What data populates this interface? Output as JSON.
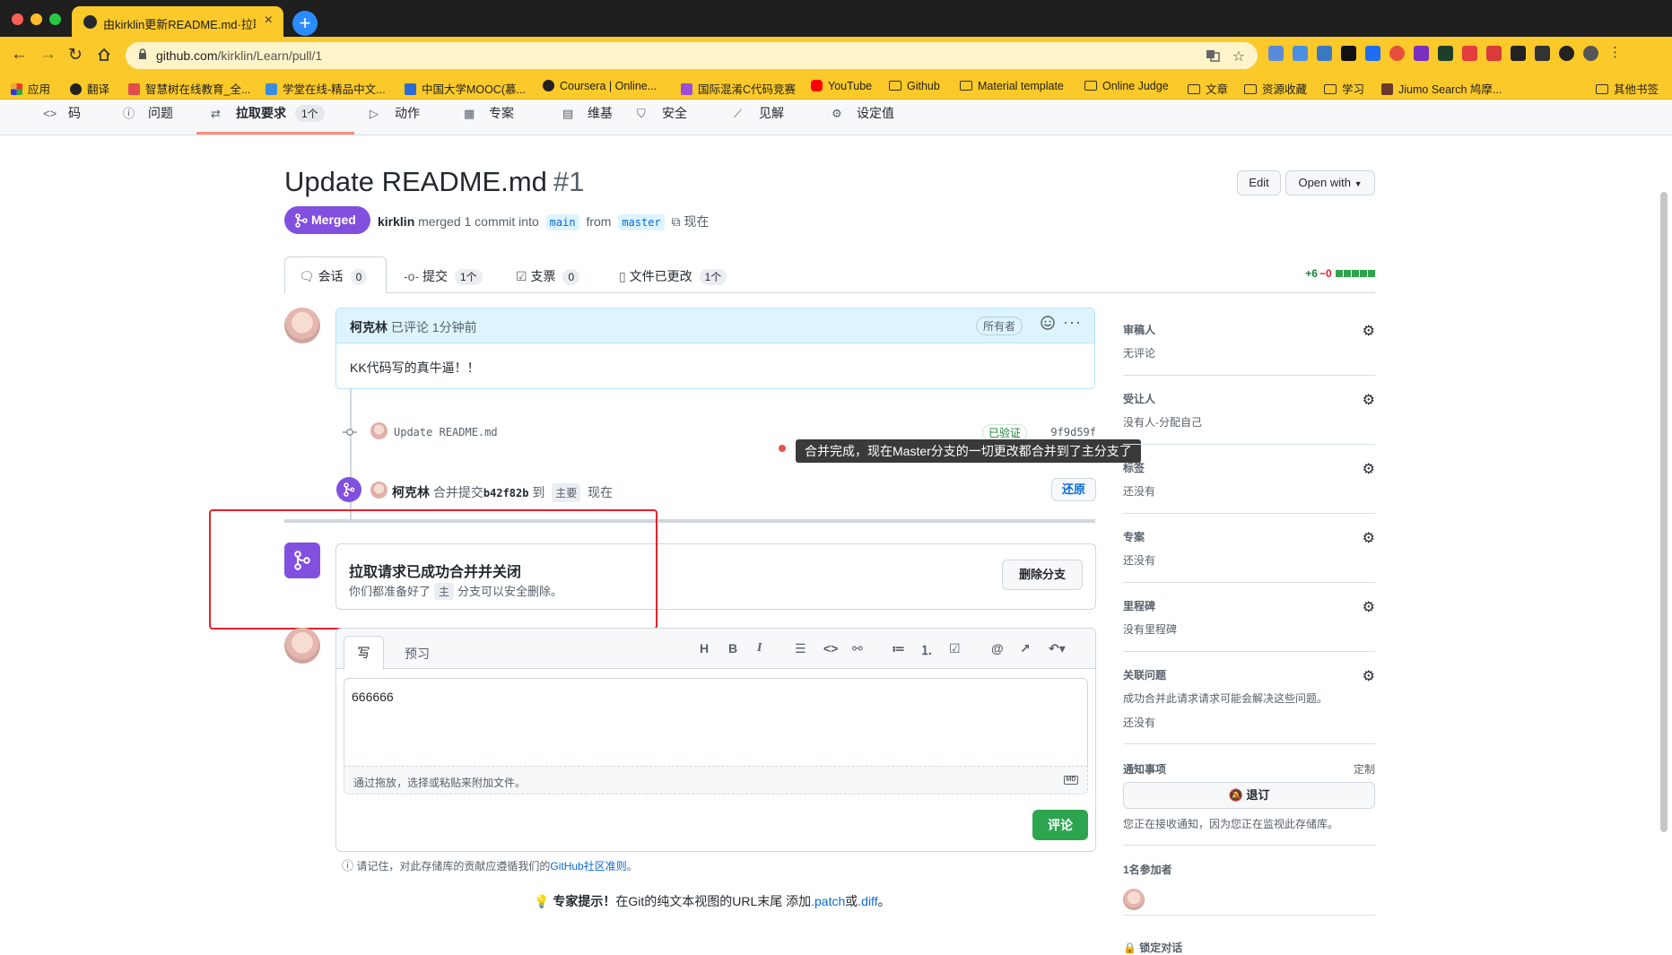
{
  "browser": {
    "tab_title": "由kirklin更新README.md·拉取…",
    "url_host": "github.com",
    "url_path": "/kirklin/Learn/pull/1",
    "bookmarks": [
      "应用",
      "翻译",
      "智慧树在线教育_全...",
      "学堂在线-精品中文...",
      "中国大学MOOC(慕...",
      "Coursera | Online...",
      "国际混淆C代码竞赛",
      "YouTube",
      "Github",
      "Material template",
      "Online Judge",
      "文章",
      "资源收藏",
      "学习",
      "Jiumo Search 鸠摩...",
      "其他书签"
    ],
    "colors": {
      "accent": "#fbc92a"
    }
  },
  "repo_nav": {
    "code": "码",
    "issues": "问题",
    "pulls": "拉取要求",
    "pulls_count": "1个",
    "actions": "动作",
    "projects": "专案",
    "wiki": "维基",
    "security": "安全",
    "insights": "见解",
    "settings": "设定值"
  },
  "pr": {
    "title": "Update README.md",
    "number": "#1",
    "edit": "Edit",
    "open_with": "Open with",
    "state": "Merged",
    "author": "kirklin",
    "meta_text": "merged 1 commit into",
    "base": "main",
    "from": "from",
    "head": "master",
    "time": "现在"
  },
  "pr_tabs": [
    {
      "label": "会话",
      "count": "0"
    },
    {
      "label": "提交",
      "count": "1个"
    },
    {
      "label": "支票",
      "count": "0"
    },
    {
      "label": "文件已更改",
      "count": "1个"
    }
  ],
  "diffstat": {
    "add": "+6",
    "del": "−0"
  },
  "comment": {
    "author": "柯克林",
    "action": "已评论 1分钟前",
    "role": "所有者",
    "body": "KK代码写的真牛逼！！"
  },
  "commit": {
    "message": "Update README.md",
    "verified": "已验证",
    "sha": "9f9d59f"
  },
  "tooltip": "合并完成，现在Master分支的一切更改都合并到了主分支了",
  "merge_event": {
    "author": "柯克林",
    "text": "合并提交",
    "sha": "b42f82b",
    "to": "到",
    "branch": "主要",
    "time": "现在",
    "revert": "还原"
  },
  "merged_box": {
    "title": "拉取请求已成功合并并关闭",
    "sub_pre": "你们都准备好了",
    "branch": "主",
    "sub_post": "分支可以安全删除。",
    "delete": "删除分支"
  },
  "new_comment": {
    "write": "写",
    "preview": "预习",
    "text": "666666",
    "attach": "通过拖放，选择或粘贴来附加文件。",
    "md": "MD",
    "submit": "评论"
  },
  "guideline": {
    "text": "请记住，对此存储库的贡献应遵循我们的",
    "link": "GitHub社区准则",
    "end": "。"
  },
  "protip": {
    "label": "专家提示！",
    "text": "在Git的纯文本视图的URL末尾 添加",
    "patch": ".patch",
    "or": "或",
    "diff": ".diff",
    "end": "。"
  },
  "sidebar": {
    "reviewers": {
      "title": "审稿人",
      "value": "无评论"
    },
    "assignees": {
      "title": "受让人",
      "value": "没有人-分配自己"
    },
    "labels": {
      "title": "标签",
      "value": "还没有"
    },
    "projects": {
      "title": "专案",
      "value": "还没有"
    },
    "milestone": {
      "title": "里程碑",
      "value": "没有里程碑"
    },
    "linked": {
      "title": "关联问题",
      "value1": "成功合并此请求请求可能会解决这些问题。",
      "value2": "还没有"
    },
    "notifications": {
      "title": "通知事项",
      "customize": "定制",
      "unsubscribe": "退订",
      "reason": "您正在接收通知，因为您正在监视此存储库。"
    },
    "participants": {
      "title": "1名参加者"
    },
    "lock": "锁定对话"
  }
}
